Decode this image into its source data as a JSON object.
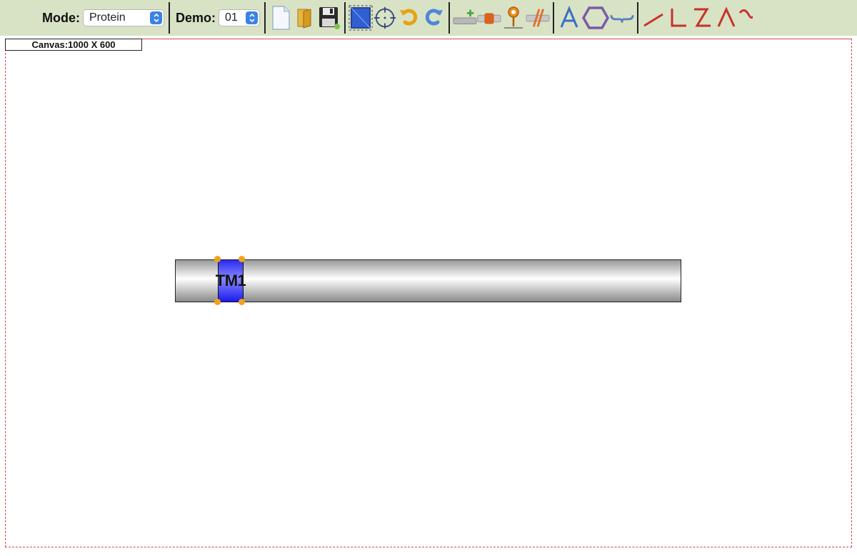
{
  "toolbar": {
    "mode_label": "Mode:",
    "mode_value": "Protein",
    "demo_label": "Demo:",
    "demo_value": "01",
    "icons": [
      "new-file-icon",
      "open-folder-icon",
      "save-icon",
      "resize-canvas-icon",
      "center-target-icon",
      "undo-icon",
      "redo-icon",
      "add-domain-icon",
      "domain-block-icon",
      "marker-pin-icon",
      "break-lines-icon",
      "text-icon",
      "hexagon-icon",
      "brace-icon",
      "line-icon",
      "angle-line-icon",
      "zigzag-line-icon",
      "arc-line-icon",
      "wave-line-icon"
    ]
  },
  "canvas": {
    "size_label": "Canvas:1000 X 600"
  },
  "domain": {
    "label": "TM1"
  },
  "colors": {
    "toolbar_bg": "#d8e3c6",
    "canvas_border": "#d04848",
    "domain_fill": "#2b2bf0",
    "handle": "#f0a21c",
    "select_arrow": "#3b82e6"
  }
}
